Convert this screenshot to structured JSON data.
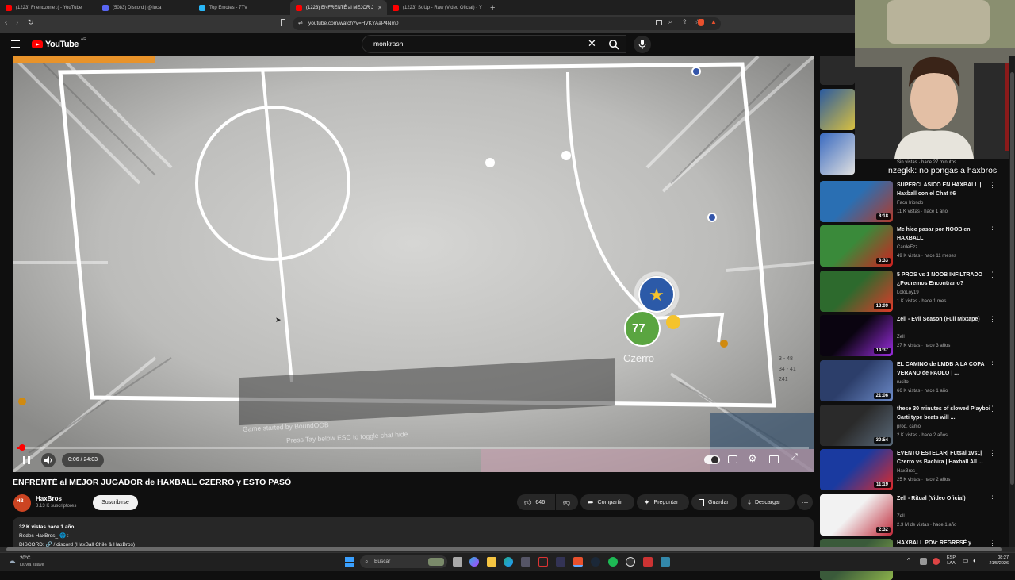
{
  "browser": {
    "tabs": [
      {
        "label": "(1223) Friendzone :( - YouTube",
        "fav": "#ff0000",
        "active": false
      },
      {
        "label": "(5083) Discord | @luca",
        "fav": "#5865f2",
        "active": false
      },
      {
        "label": "Top Emotes - 7TV",
        "fav": "#29b6f6",
        "active": false
      },
      {
        "label": "(1223) ENFRENTÉ al MEJOR J",
        "fav": "#ff0000",
        "active": true
      },
      {
        "label": "(1223) SoUp - Raw (Video Oficial) - Y",
        "fav": "#ff0000",
        "active": false
      }
    ],
    "new_tab": "+",
    "url": "youtube.com/watch?v=HVKYAaP4Nm0"
  },
  "header": {
    "logo_text": "YouTube",
    "region": "AR",
    "search_value": "monkrash"
  },
  "video": {
    "time": "0:06 / 24:03",
    "progress": 0.004,
    "overlay_text_1": "Game started by BoundOOB",
    "overlay_text_2": "Press Tay below ESC to toggle chat hide",
    "player_name": "Czerro",
    "player_number": "77",
    "side_score_1": "3 - 48",
    "side_score_2": "34 - 41",
    "side_score_3": "241"
  },
  "info": {
    "title": "ENFRENTÉ al MEJOR JUGADOR de HAXBALL CZERRO y ESTO PASÓ",
    "channel": "HaxBros_",
    "subs": "3.13 K suscriptores",
    "subscribe": "Suscribirse",
    "likes": "646",
    "share": "Compartir",
    "ask": "Preguntar",
    "save": "Guardar",
    "download": "Descargar",
    "desc_stats": "32 K vistas  hace 1 año",
    "desc_line2": "Redes HaxBros_ 🌐 :",
    "desc_line3": "DISCORD: 🔗 / discord   (HaxBall Chile & HaxBros)"
  },
  "webcam": {
    "chat_message": "nzegkk: no pongas a haxbros",
    "chat_meta": "Sin vistas · hace 27 minutos"
  },
  "recs": [
    {
      "title": "SUPERCLASICO EN HAXBALL | Haxball con el Chat #6",
      "channel": "Facu Iriondo",
      "meta": "11 K vistas · hace 1 año",
      "dur": "8:18",
      "c1": "#2a6fb3",
      "c2": "#b33a2a"
    },
    {
      "title": "Me hice pasar por NOOB en HAXBALL",
      "channel": "CardeEzz",
      "meta": "49 K vistas · hace 11 meses",
      "dur": "3:33",
      "c1": "#3a8a3a",
      "c2": "#d02020"
    },
    {
      "title": "5 PROS vs 1 NOOB INFILTRADO ¿Podremos Encontrarlo?",
      "channel": "LoloLoy19",
      "meta": "1 K vistas · hace 1 mes",
      "dur": "13:09",
      "c1": "#2d6a2d",
      "c2": "#e0392a"
    },
    {
      "title": "Zell - Evil Season (Full Mixtape)",
      "channel": "Zell",
      "meta": "27 K vistas · hace 3 años",
      "dur": "14:37",
      "c1": "#0a0410",
      "c2": "#9b2de0"
    },
    {
      "title": "EL CAMINO de LMDB A LA COPA VERANO de PAOLO | ...",
      "channel": "rusito",
      "meta": "66 K vistas · hace 1 año",
      "dur": "21:06",
      "c1": "#2c3e6a",
      "c2": "#6c8ac8"
    },
    {
      "title": "these 30 minutes of slowed Playboi Carti type beats will ...",
      "channel": "prod. camo",
      "meta": "2 K vistas · hace 2 años",
      "dur": "30:54",
      "c1": "#2a2a2a",
      "c2": "#5a6a7a"
    },
    {
      "title": "EVENTO ESTELAR| Futsal 1vs1| Czerro vs Bachira | Haxball All ...",
      "channel": "HaxBros_",
      "meta": "25 K vistas · hace 2 años",
      "dur": "11:19",
      "c1": "#1a3aa0",
      "c2": "#e02a2a"
    },
    {
      "title": "Zell - Ritual (Video Oficial)",
      "channel": "Zell",
      "meta": "2.3 M de vistas · hace 1 año",
      "dur": "2:32",
      "c1": "#f2f2f2",
      "c2": "#c02a3a"
    },
    {
      "title": "HAXBALL POV: REGRESÉ y",
      "channel": "",
      "meta": "",
      "dur": "",
      "c1": "#3a5a3a",
      "c2": "#8ab04a"
    }
  ],
  "taskbar": {
    "weather_temp": "20°C",
    "weather_desc": "Lluvia suave",
    "search": "Buscar",
    "lang_1": "ESP",
    "lang_2": "LAA",
    "time": "08:27",
    "date": "21/5/2026"
  },
  "colors": {
    "accent": "#ff0000",
    "bg": "#0f0f0f",
    "pill": "#272727"
  }
}
